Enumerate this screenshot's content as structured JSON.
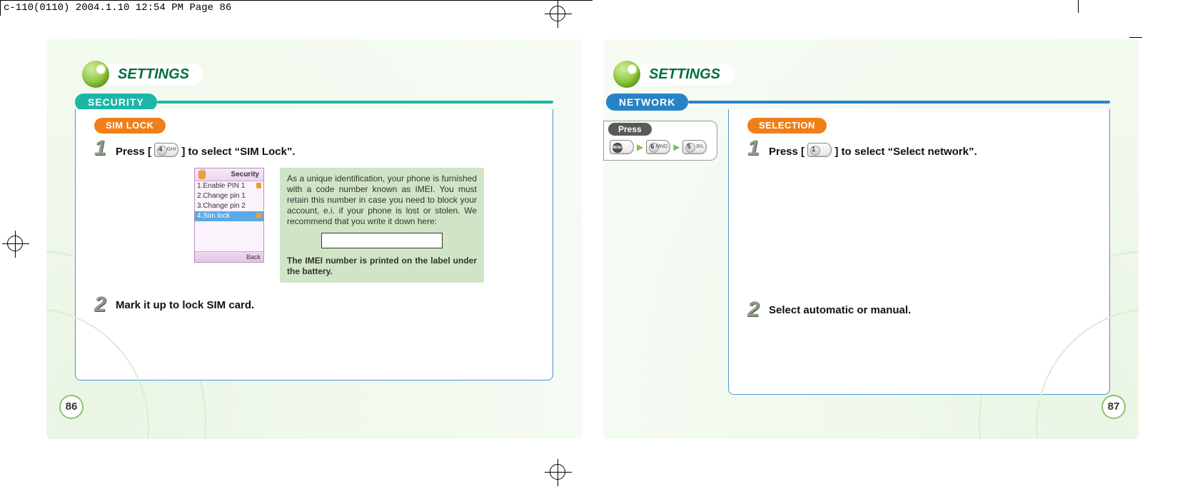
{
  "header_tag": "c-110(0110)  2004.1.10  12:54 PM  Page 86",
  "left": {
    "settings_label": "SETTINGS",
    "section_label": "SECURITY",
    "sub_label": "SIM LOCK",
    "step1": {
      "num": "1",
      "press_before": "Press [",
      "press_after": "] to select “SIM Lock”.",
      "key_num": "4",
      "key_letters": "GHI"
    },
    "phone": {
      "title": "Security",
      "items": [
        "1.Enable PIN 1",
        "2.Change pin 1",
        "3.Change pin 2",
        "4.Sim lock"
      ],
      "softkey": "Back"
    },
    "info": {
      "para": "As a unique identification, your phone is furnished with a code number known as IMEI. You must retain this number in case you need to block your account, e.i. if your phone is lost or stolen. We recommend that you write it down here:",
      "bold": "The IMEI number is printed on the label under the battery."
    },
    "step2": {
      "num": "2",
      "text": "Mark it up to lock SIM card."
    },
    "page_num": "86"
  },
  "right": {
    "settings_label": "SETTINGS",
    "section_label": "NETWORK",
    "press_label": "Press",
    "keys": {
      "k1": {
        "num": "MENU",
        "cls": "menu-key"
      },
      "k2": {
        "num": "6",
        "ltr": "MNO"
      },
      "k3": {
        "num": "5",
        "ltr": "JKL"
      }
    },
    "sub_label": "SELECTION",
    "step1": {
      "num": "1",
      "press_before": "Press [",
      "press_after": "] to select “Select network”.",
      "key_num": "1",
      "key_letters": ""
    },
    "step2": {
      "num": "2",
      "text": "Select automatic or manual."
    },
    "page_num": "87"
  }
}
